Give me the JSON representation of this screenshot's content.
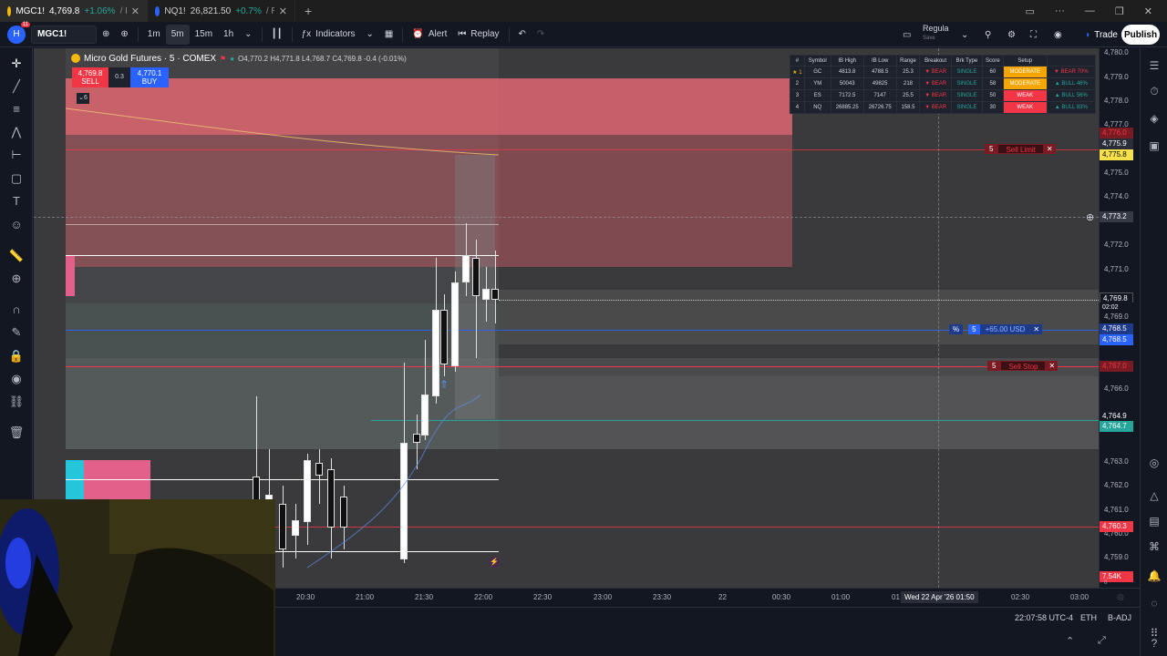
{
  "browser": {
    "tabs": [
      {
        "symbol": "MGC1!",
        "price": "4,769.8",
        "change": "+1.06%",
        "rest": "/ Re"
      },
      {
        "symbol": "NQ1!",
        "price": "26,821.50",
        "change": "+0.7%",
        "rest": "/ Re"
      }
    ],
    "new_tab": "+"
  },
  "toolbar": {
    "avatar_letter": "H",
    "avatar_badge": "11",
    "symbol": "MGC1!",
    "intervals": [
      "1m",
      "5m",
      "15m",
      "1h"
    ],
    "selected_interval": "5m",
    "indicators_label": "Indicators",
    "alert_label": "Alert",
    "replay_label": "Replay",
    "layout_name": "Regula",
    "layout_sub": "Save",
    "trade_label": "Trade",
    "publish_label": "Publish"
  },
  "legend": {
    "title": "Micro Gold Futures · 5 · COMEX",
    "o_label": "O",
    "open": "4,770.2",
    "h_label": "H",
    "high": "4,771.8",
    "l_label": "L",
    "low": "4,768.7",
    "c_label": "C",
    "close": "4,769.8",
    "change": "-0.4 (-0.01%)",
    "sell_price": "4,769.8",
    "sell_label": "SELL",
    "spread": "0.3",
    "buy_price": "4,770.1",
    "buy_label": "BUY",
    "collapse_count": "6"
  },
  "scanner": {
    "headers": [
      "#",
      "Symbol",
      "IB High",
      "IB Low",
      "Range",
      "Breakout",
      "Brk Type",
      "Score",
      "Setup"
    ],
    "rows": [
      {
        "rank": "★ 1",
        "symbol": "GC",
        "ib_high": "4813.8",
        "ib_low": "4788.5",
        "range": "25.3",
        "breakout": "▼ BEAR",
        "brk_type": "SINGLE",
        "score": "60",
        "setup": "MODERATE",
        "bias": "▼ BEAR 70%"
      },
      {
        "rank": "2",
        "symbol": "YM",
        "ib_high": "50043",
        "ib_low": "49825",
        "range": "218",
        "breakout": "▼ BEAR",
        "brk_type": "SINGLE",
        "score": "58",
        "setup": "MODERATE",
        "bias": "▲ BULL 46%"
      },
      {
        "rank": "3",
        "symbol": "ES",
        "ib_high": "7172.5",
        "ib_low": "7147",
        "range": "25.5",
        "breakout": "▼ BEAR",
        "brk_type": "SINGLE",
        "score": "50",
        "setup": "WEAK",
        "bias": "▲ BULL 56%"
      },
      {
        "rank": "4",
        "symbol": "NQ",
        "ib_high": "26885.25",
        "ib_low": "26726.75",
        "range": "158.5",
        "breakout": "▼ BEAR",
        "brk_type": "SINGLE",
        "score": "30",
        "setup": "WEAK",
        "bias": "▲ BULL 83%"
      }
    ]
  },
  "orders": {
    "sell_limit": {
      "qty": "5",
      "label": "Sell Limit",
      "close": "✕"
    },
    "sell_stop": {
      "qty": "5",
      "label": "Sell Stop",
      "close": "✕"
    },
    "position": {
      "pct": "%",
      "qty": "5",
      "pl": "+65.00 USD",
      "close": "✕"
    }
  },
  "price_axis": {
    "ticks": [
      "4,780.0",
      "4,779.0",
      "4,778.0",
      "4,777.0",
      "4,775.0",
      "4,774.0",
      "4,772.0",
      "4,771.0",
      "4,769.0",
      "4,766.0",
      "4,763.0",
      "4,762.0",
      "4,761.0",
      "4,760.0",
      "4,759.0"
    ],
    "labels": {
      "sell_limit_price": "4,776.0",
      "level_1": "4,775.9",
      "level_2": "4,775.8",
      "crosshair": "4,773.2",
      "last": "4,769.8",
      "countdown": "02:02",
      "pos_1": "4,768.5",
      "pos_2": "4,768.5",
      "sell_stop_price": "4,767.0",
      "green_1": "4,764.9",
      "green_2": "4,764.7",
      "red_low": "4,760.3",
      "volume": "7.54K",
      "zero": "0"
    }
  },
  "time_axis": {
    "ticks": [
      "20:30",
      "21:00",
      "21:30",
      "22:00",
      "22:30",
      "23:00",
      "23:30",
      "22",
      "00:30",
      "01:00",
      "01",
      "02:30",
      "03:00"
    ],
    "crosshair": "Wed 22 Apr '26  01:50"
  },
  "status": {
    "clock": "22:07:58 UTC-4",
    "session": "ETH",
    "adjust": "B-ADJ"
  },
  "colors": {
    "bear": "#f23645",
    "bull": "#26a69a",
    "accent": "#2962ff",
    "zone_red": "#e06672",
    "chart_bg": "#3a3a3d"
  }
}
